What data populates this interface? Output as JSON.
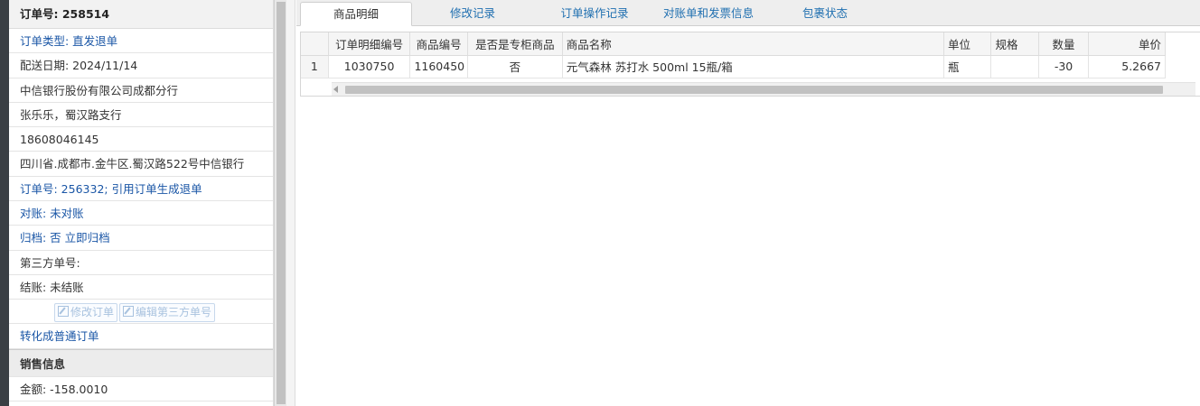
{
  "order": {
    "header": "订单号: 258514",
    "type": "订单类型: 直发退单",
    "delivery_date": "配送日期: 2024/11/14",
    "company": "中信银行股份有限公司成都分行",
    "contact": "张乐乐，蜀汉路支行",
    "phone": "18608046145",
    "address": "四川省.成都市.金牛区.蜀汉路522号中信银行",
    "ref_order": "订单号: 256332; 引用订单生成退单",
    "reconcile": "对账: 未对账",
    "archive": "归档:  否 立即归档",
    "third_party": "第三方单号:",
    "settle": "结账: 未结账",
    "edit_order_btn": "修改订单",
    "edit_third_btn": "编辑第三方单号",
    "convert_link": "转化成普通订单"
  },
  "sales": {
    "header": "销售信息",
    "amount": "金额: -158.0010"
  },
  "tabs": [
    {
      "label": "商品明细"
    },
    {
      "label": "修改记录"
    },
    {
      "label": "订单操作记录"
    },
    {
      "label": "对账单和发票信息"
    },
    {
      "label": "包裹状态"
    }
  ],
  "grid": {
    "columns": [
      "订单明细编号",
      "商品编号",
      "是否是专柜商品",
      "商品名称",
      "单位",
      "规格",
      "数量",
      "单价"
    ],
    "rows": [
      {
        "row_num": "1",
        "detail_id": "1030750",
        "product_id": "1160450",
        "is_counter": "否",
        "name": "元气森林 苏打水 500ml 15瓶/箱",
        "unit": "瓶",
        "spec": "",
        "qty": "-30",
        "price": "5.2667"
      }
    ]
  },
  "colors": {
    "link_blue": "#1a56a6",
    "tab_blue": "#1f6fb0",
    "disabled_btn": "#a8c2df"
  }
}
